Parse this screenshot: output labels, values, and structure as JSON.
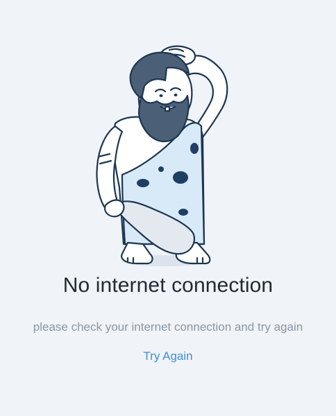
{
  "illustration": {
    "icon": "caveman-illustration"
  },
  "message": {
    "title": "No internet connection",
    "subtitle": "please check your internet connection and try again"
  },
  "actions": {
    "retry_label": "Try Again"
  },
  "colors": {
    "background": "#f0f3f7",
    "accent": "#3b8fd9",
    "title": "#222a33",
    "subtitle": "#8a97a5",
    "outline": "#1d3650",
    "hair": "#4b6077",
    "garment": "#d8e9f8",
    "spot": "#1f3f63"
  }
}
